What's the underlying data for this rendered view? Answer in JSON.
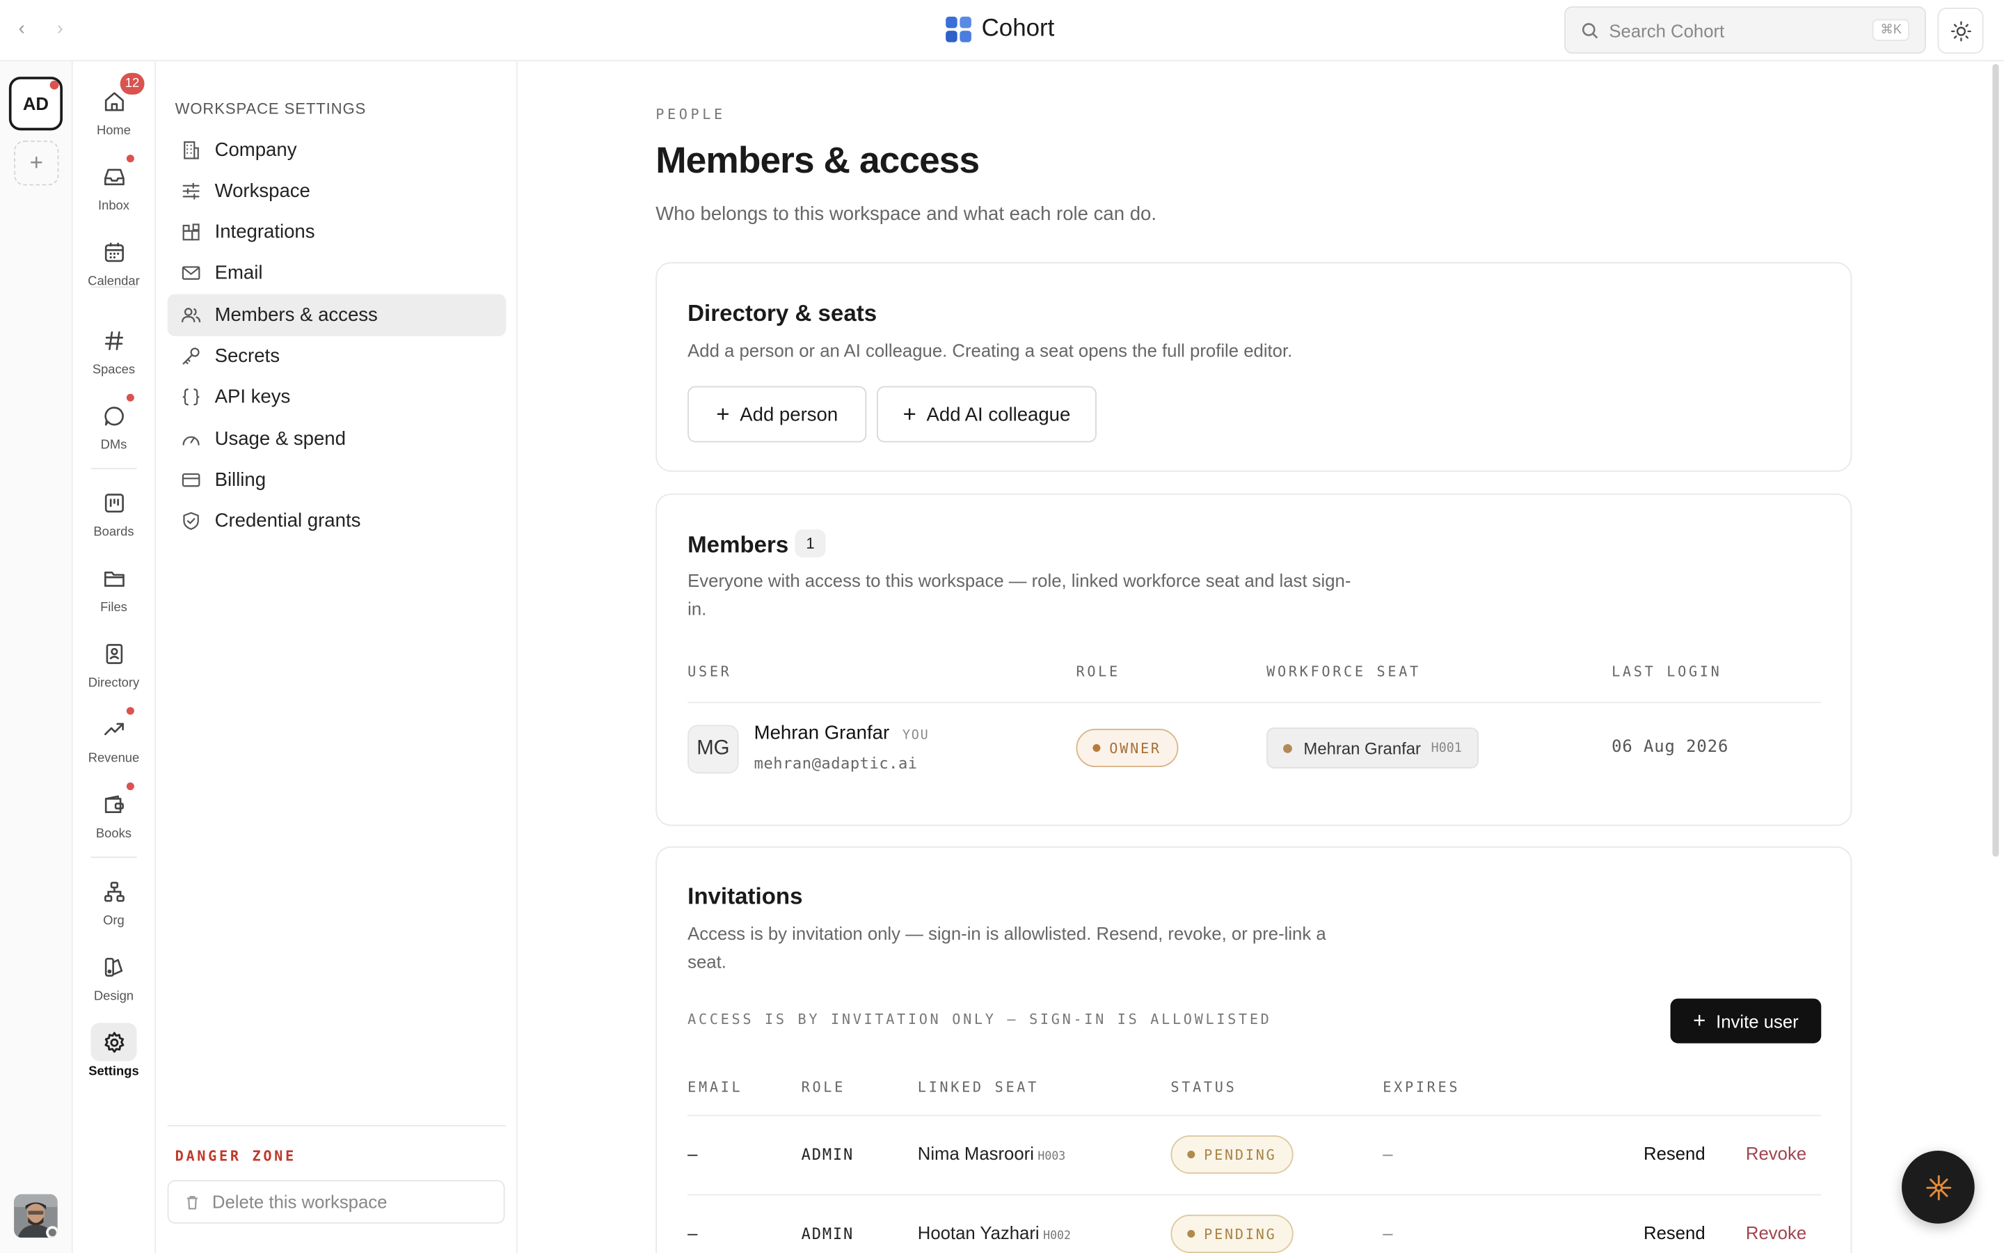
{
  "app": {
    "name": "Cohort"
  },
  "colors": {
    "accent": "#3b6fd8",
    "danger": "#c0392b",
    "pending": "#a78445",
    "owner": "#a5703a"
  },
  "topbar": {
    "back_icon": "chevron-left-icon",
    "forward_icon": "chevron-right-icon",
    "search_placeholder": "Search Cohort",
    "search_shortcut": "⌘K",
    "theme_icon": "sun-icon"
  },
  "rail": {
    "workspace_initials": "AD",
    "add_label": "+"
  },
  "nav": {
    "home_badge": "12",
    "items": [
      {
        "label": "Home",
        "icon": "home-icon"
      },
      {
        "label": "Inbox",
        "icon": "inbox-icon"
      },
      {
        "label": "Calendar",
        "icon": "calendar-icon"
      },
      {
        "label": "Spaces",
        "icon": "hash-icon"
      },
      {
        "label": "DMs",
        "icon": "chat-icon"
      },
      {
        "label": "Boards",
        "icon": "board-icon"
      },
      {
        "label": "Files",
        "icon": "folder-icon"
      },
      {
        "label": "Directory",
        "icon": "contact-icon"
      },
      {
        "label": "Revenue",
        "icon": "trend-icon"
      },
      {
        "label": "Books",
        "icon": "wallet-icon"
      },
      {
        "label": "Org",
        "icon": "org-icon"
      },
      {
        "label": "Design",
        "icon": "design-icon"
      },
      {
        "label": "Settings",
        "icon": "gear-icon"
      }
    ]
  },
  "settings": {
    "heading": "WORKSPACE SETTINGS",
    "items": [
      {
        "label": "Company",
        "icon": "building-icon"
      },
      {
        "label": "Workspace",
        "icon": "sliders-icon"
      },
      {
        "label": "Integrations",
        "icon": "puzzle-icon"
      },
      {
        "label": "Email",
        "icon": "mail-icon"
      },
      {
        "label": "Members & access",
        "icon": "users-icon"
      },
      {
        "label": "Secrets",
        "icon": "key-icon"
      },
      {
        "label": "API keys",
        "icon": "braces-icon"
      },
      {
        "label": "Usage & spend",
        "icon": "gauge-icon"
      },
      {
        "label": "Billing",
        "icon": "card-icon"
      },
      {
        "label": "Credential grants",
        "icon": "shield-icon"
      }
    ],
    "danger_heading": "DANGER ZONE",
    "delete_label": "Delete this workspace"
  },
  "page": {
    "eyebrow": "PEOPLE",
    "title": "Members & access",
    "subtitle": "Who belongs to this workspace and what each role can do."
  },
  "directory": {
    "title": "Directory & seats",
    "desc": "Add a person or an AI colleague. Creating a seat opens the full profile editor.",
    "add_person": "Add person",
    "add_ai": "Add AI colleague"
  },
  "members": {
    "title": "Members",
    "count": "1",
    "desc_line1": "Everyone with access to this workspace — role, linked workforce seat and last sign-",
    "desc_line2": "in.",
    "columns": [
      "USER",
      "ROLE",
      "WORKFORCE SEAT",
      "LAST LOGIN"
    ],
    "rows": [
      {
        "initials": "MG",
        "name": "Mehran Granfar",
        "you": "YOU",
        "email": "mehran@adaptic.ai",
        "role": "OWNER",
        "seat_name": "Mehran Granfar",
        "seat_code": "H001",
        "last_login": "06 Aug 2026"
      }
    ]
  },
  "invitations": {
    "title": "Invitations",
    "desc_line1": "Access is by invitation only — sign-in is allowlisted. Resend, revoke, or pre-link a",
    "desc_line2": "seat.",
    "notice": "ACCESS IS BY INVITATION ONLY — SIGN-IN IS ALLOWLISTED",
    "invite_button": "Invite user",
    "columns": [
      "EMAIL",
      "ROLE",
      "LINKED SEAT",
      "STATUS",
      "EXPIRES"
    ],
    "rows": [
      {
        "email": "–",
        "role": "ADMIN",
        "seat_name": "Nima Masroori",
        "seat_code": "H003",
        "status": "PENDING",
        "expires": "–",
        "resend": "Resend",
        "revoke": "Revoke"
      },
      {
        "email": "–",
        "role": "ADMIN",
        "seat_name": "Hootan Yazhari",
        "seat_code": "H002",
        "status": "PENDING",
        "expires": "–",
        "resend": "Resend",
        "revoke": "Revoke"
      }
    ]
  }
}
